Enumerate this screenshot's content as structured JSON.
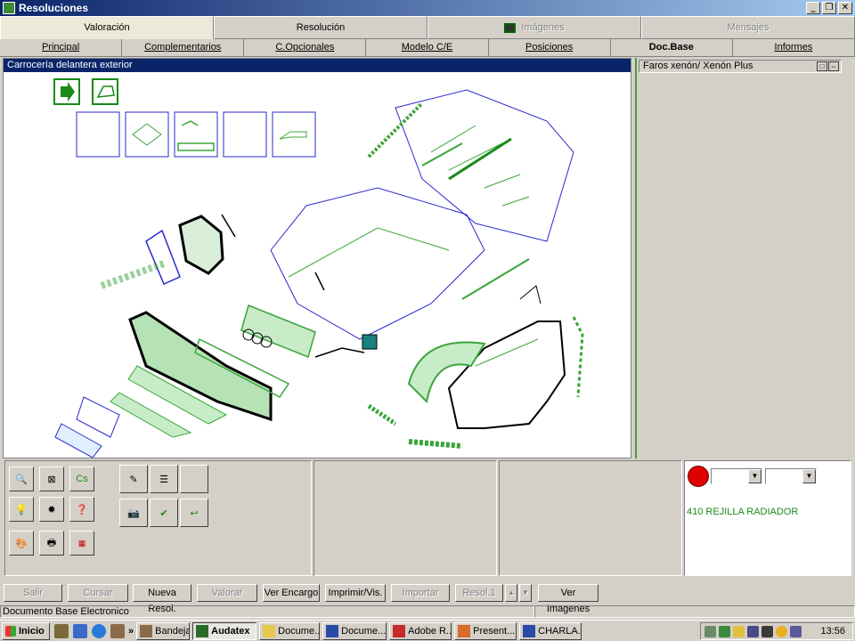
{
  "window": {
    "title": "Resoluciones"
  },
  "main_tabs": [
    {
      "label": "Valoración",
      "active": true,
      "disabled": false
    },
    {
      "label": "Resolución",
      "active": false,
      "disabled": false
    },
    {
      "label": "Imágenes",
      "active": false,
      "disabled": true,
      "icon": "monitor-icon"
    },
    {
      "label": "Mensajes",
      "active": false,
      "disabled": true
    }
  ],
  "sub_tabs": [
    {
      "label": "Principal"
    },
    {
      "label": "Complementarios"
    },
    {
      "label": "C.Opcionales"
    },
    {
      "label": "Modelo C/E"
    },
    {
      "label": "Posiciones"
    },
    {
      "label": "Doc.Base",
      "active": true
    },
    {
      "label": "Informes"
    }
  ],
  "drawing": {
    "title": "Carrocería delantera exterior"
  },
  "detail_panel": {
    "title": "Faros xenón/ Xenón Plus"
  },
  "tool_panel": {
    "cs_label": "Cs",
    "selected_part": "410  REJILLA RADIADOR",
    "status_color": "#e00000"
  },
  "actions": {
    "salir": "Salir",
    "cursar": "Cursar",
    "nueva_resol": "Nueva Resol.",
    "valorar": "Valorar",
    "ver_encargo": "Ver Encargo",
    "imprimir": "Imprimir/Vis.",
    "importar": "Importar",
    "resol": "Resol.1",
    "ver_imagenes": "Ver Imagenes"
  },
  "status": {
    "text": "Documento Base Electronico"
  },
  "taskbar": {
    "start": "Inicio",
    "chevron": "»",
    "tasks": [
      {
        "label": "Bandeja...",
        "active": false
      },
      {
        "label": "Audatex",
        "active": true
      },
      {
        "label": "Docume...",
        "active": false
      },
      {
        "label": "Docume...",
        "active": false
      },
      {
        "label": "Adobe R...",
        "active": false
      },
      {
        "label": "Present...",
        "active": false
      },
      {
        "label": "CHARLA...",
        "active": false
      }
    ],
    "clock": "13:56"
  },
  "colors": {
    "accent": "#0a246a",
    "drawing_green": "#3aa53a",
    "drawing_blue": "#2a2acc"
  }
}
